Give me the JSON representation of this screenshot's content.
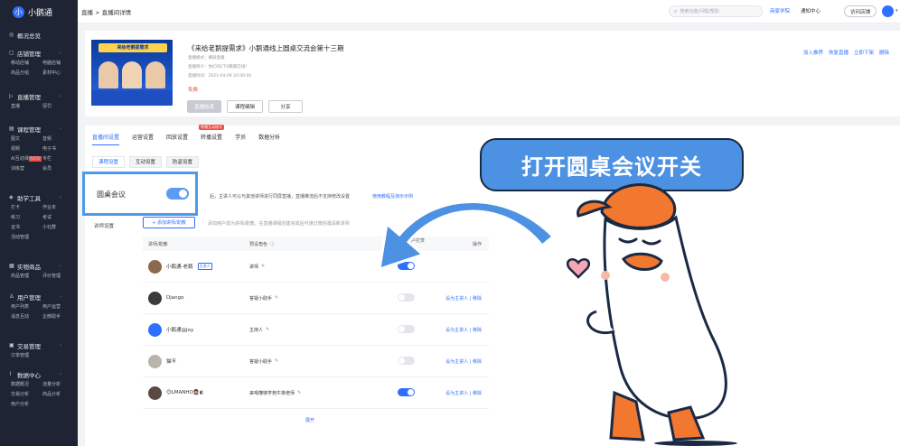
{
  "logo": {
    "mark": "小",
    "text": "小鹅通"
  },
  "sidebar": [
    {
      "icon": "◎",
      "label": "概况总览",
      "sub": []
    },
    {
      "icon": "▢",
      "label": "店铺管理",
      "sub": [
        "移动店铺",
        "电脑店铺",
        "商品分组",
        "素材中心"
      ]
    },
    {
      "icon": "▷",
      "label": "直播管理",
      "sub": [
        "直播",
        "惩罚"
      ]
    },
    {
      "icon": "▤",
      "label": "课程管理",
      "sub": [
        "图文",
        "音频",
        "视频",
        "电子书",
        "AI互动课",
        "专栏",
        "训练营",
        "会员"
      ]
    },
    {
      "icon": "◈",
      "label": "助学工具",
      "sub": [
        "打卡",
        "作业本",
        "练习",
        "考试",
        "证书",
        "小社群",
        "活动管理"
      ]
    },
    {
      "icon": "▦",
      "label": "实物商品",
      "sub": [
        "商品管理",
        "评价管理"
      ]
    },
    {
      "icon": "♙",
      "label": "用户管理",
      "sub": [
        "用户列表",
        "用户运营",
        "消息互动",
        "企微助手"
      ]
    },
    {
      "icon": "▣",
      "label": "交易管理",
      "sub": [
        "订单管理"
      ]
    },
    {
      "icon": "⌇",
      "label": "数据中心",
      "sub": [
        "数据概况",
        "流量分析",
        "交易分析",
        "商品分析",
        "用户分析"
      ]
    }
  ],
  "sidebar_new_tag": "NEW",
  "topbar": {
    "breadcrumb": "直播 > 直播间详情",
    "search_placeholder": "搜索功能/问题/帮助",
    "links": [
      "商家学院",
      "通知中心"
    ],
    "visit_label": "访问店铺"
  },
  "live": {
    "cover_banner": "来给老鹅提需求",
    "title": "《来给老鹅提需求》小鹅通线上圆桌交流会第十三期",
    "meta": [
      "直播模式：横屏直播",
      "直播简介：你们的CTO瞧瞧在线！",
      "直播时间：2021-04-09 20:00:00"
    ],
    "price": "免费",
    "buttons": [
      "直播结束",
      "课程编辑",
      "分享"
    ],
    "actions": [
      "加入推荐",
      "恢复直播",
      "立即下架",
      "删除"
    ]
  },
  "tabs": [
    {
      "label": "直播间设置",
      "active": true
    },
    {
      "label": "运营设置",
      "active": false
    },
    {
      "label": "回放设置",
      "active": false
    },
    {
      "label": "转播设置",
      "active": false,
      "badge": "转播互动账号"
    },
    {
      "label": "学员",
      "active": false
    },
    {
      "label": "数据分析",
      "active": false
    }
  ],
  "subtabs": [
    {
      "label": "课程设置",
      "active": true
    },
    {
      "label": "互动设置",
      "active": false
    },
    {
      "label": "防盗设置",
      "active": false
    }
  ],
  "roundtable": {
    "label": "圆桌会议",
    "enabled": true,
    "desc": "后，主讲人可以与其他讲师进行同屏直播，直播推流后不支持修改设置",
    "link": "使用教程及演示示例"
  },
  "lecturers": {
    "label": "讲师设置",
    "add_label": "+ 添加讲师/助教",
    "hint": "添加用户成为讲师/助教，在直播课程创建完成后可通过微信邀请新讲师",
    "columns": [
      "讲师/助教",
      "预设角色",
      "接受用户打赏",
      "操作"
    ],
    "rows": [
      {
        "name": "小鹅通-老鹅",
        "tag": "主讲人",
        "role": "讲师",
        "reward": true,
        "ops": ""
      },
      {
        "name": "Django",
        "tag": "",
        "role": "答疑小助手",
        "reward": false,
        "ops": "设为主讲人 | 移除"
      },
      {
        "name": "小鹅通@Joy",
        "tag": "",
        "role": "主持人",
        "reward": false,
        "ops": "设为主讲人 | 移除"
      },
      {
        "name": "猫不",
        "tag": "",
        "role": "答疑小助手",
        "reward": false,
        "ops": "设为主讲人 | 移除"
      },
      {
        "name": "😊LMANHO👩‍🦱◐",
        "tag": "",
        "role": "来喝懂够学苑牛排老师",
        "reward": true,
        "ops": "设为主讲人 | 移除"
      }
    ],
    "more": "展开"
  },
  "callout": {
    "text": "打开圆桌会议开关"
  },
  "colors": {
    "accent": "#2f6fff",
    "sidebar_bg": "#1e2433",
    "callout": "#4d91e2",
    "danger": "#f04a45"
  }
}
